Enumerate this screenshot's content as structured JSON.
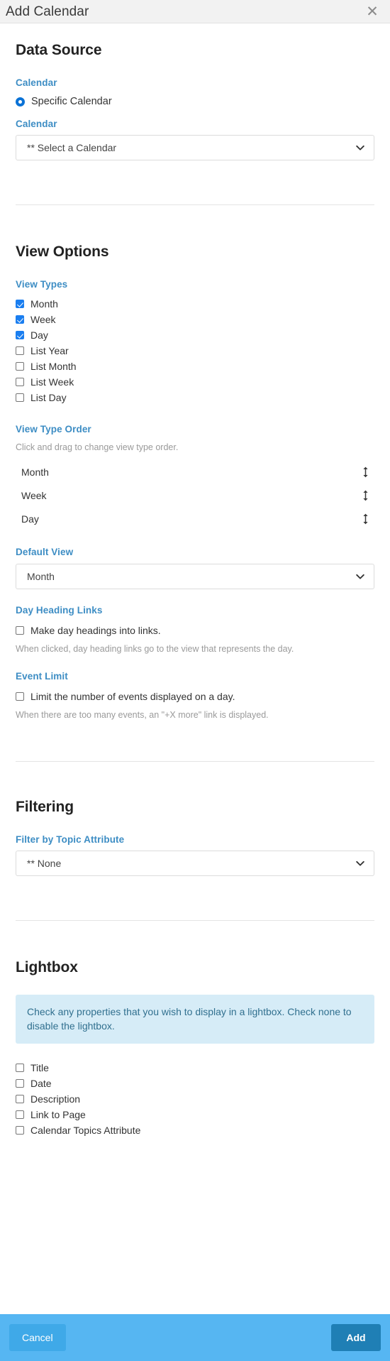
{
  "dialog": {
    "title": "Add Calendar",
    "close_icon": "close-icon"
  },
  "data_source": {
    "heading": "Data Source",
    "calendar_label": "Calendar",
    "radio_option": "Specific Calendar",
    "calendar_select_label": "Calendar",
    "calendar_select_value": "** Select a Calendar"
  },
  "view_options": {
    "heading": "View Options",
    "view_types_label": "View Types",
    "view_types": [
      {
        "label": "Month",
        "checked": true
      },
      {
        "label": "Week",
        "checked": true
      },
      {
        "label": "Day",
        "checked": true
      },
      {
        "label": "List Year",
        "checked": false
      },
      {
        "label": "List Month",
        "checked": false
      },
      {
        "label": "List Week",
        "checked": false
      },
      {
        "label": "List Day",
        "checked": false
      }
    ],
    "view_type_order_label": "View Type Order",
    "view_type_order_help": "Click and drag to change view type order.",
    "view_type_order": [
      {
        "label": "Month",
        "handle_icon": "drag-vertical-icon"
      },
      {
        "label": "Week",
        "handle_icon": "drag-vertical-icon"
      },
      {
        "label": "Day",
        "handle_icon": "drag-vertical-icon"
      }
    ],
    "default_view_label": "Default View",
    "default_view_value": "Month",
    "day_heading_links_label": "Day Heading Links",
    "day_heading_links_checkbox": "Make day headings into links.",
    "day_heading_links_help": "When clicked, day heading links go to the view that represents the day.",
    "event_limit_label": "Event Limit",
    "event_limit_checkbox": "Limit the number of events displayed on a day.",
    "event_limit_help": "When there are too many events, an \"+X more\" link is displayed."
  },
  "filtering": {
    "heading": "Filtering",
    "filter_label": "Filter by Topic Attribute",
    "filter_value": "** None"
  },
  "lightbox": {
    "heading": "Lightbox",
    "alert": "Check any properties that you wish to display in a lightbox. Check none to disable the lightbox.",
    "properties": [
      {
        "label": "Title",
        "checked": false
      },
      {
        "label": "Date",
        "checked": false
      },
      {
        "label": "Description",
        "checked": false
      },
      {
        "label": "Link to Page",
        "checked": false
      },
      {
        "label": "Calendar Topics Attribute",
        "checked": false
      }
    ]
  },
  "footer": {
    "cancel_label": "Cancel",
    "add_label": "Add"
  },
  "colors": {
    "accent_blue": "#3d8dc4",
    "checkbox_blue": "#1a7ef0",
    "footer_blue": "#56b6f2",
    "add_button_blue": "#1f7fb5",
    "alert_bg": "#d6ecf7",
    "alert_text": "#31708f"
  }
}
